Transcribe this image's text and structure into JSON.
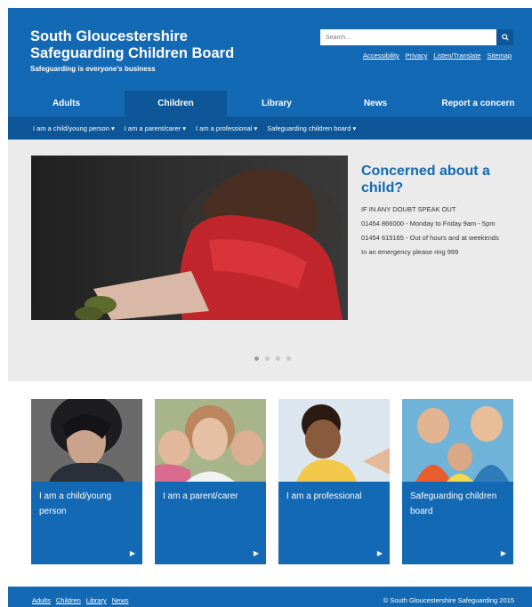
{
  "header": {
    "title_line1": "South Gloucestershire",
    "title_line2": "Safeguarding Children Board",
    "tagline": "Safeguarding is everyone's business",
    "search_placeholder": "Search...",
    "search_icon": "search-icon",
    "links": [
      "Accessibility",
      "Privacy",
      "Listen/Translate",
      "Sitemap"
    ]
  },
  "mainnav": {
    "items": [
      "Adults",
      "Children",
      "Library",
      "News",
      "Report a concern"
    ],
    "active": "Children"
  },
  "subnav": {
    "items": [
      "I am a child/young person",
      "I am a parent/carer",
      "I am a professional",
      "Safeguarding children board"
    ],
    "caret": "▾"
  },
  "hero": {
    "heading": "Concerned about a child?",
    "line1": "IF IN ANY DOUBT SPEAK OUT",
    "line2": "01454 866000 - Monday to Friday 9am - 5pm",
    "line3": "01454 615165 - Out of hours and at weekends",
    "line4": "In an emergency please ring 999",
    "slides": 4,
    "active_slide": 1
  },
  "cards": [
    {
      "label": "I am a child/young person"
    },
    {
      "label": "I am a parent/carer"
    },
    {
      "label": "I am a professional"
    },
    {
      "label": "Safeguarding children board"
    }
  ],
  "footer": {
    "links": [
      "Adults",
      "Children",
      "Library",
      "News"
    ],
    "copyright": "© South Gloucestershire Safeguarding 2015"
  },
  "colors": {
    "primary": "#1469b4",
    "dark": "#0d5798",
    "hero_bg": "#ebebeb"
  }
}
